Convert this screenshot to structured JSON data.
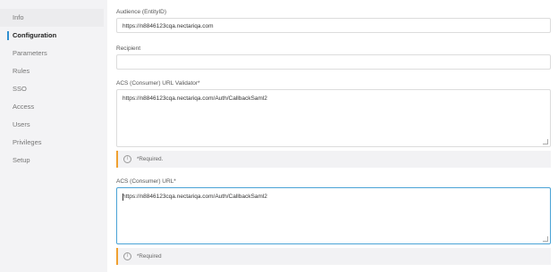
{
  "sidebar": {
    "items": [
      {
        "label": "Info"
      },
      {
        "label": "Configuration"
      },
      {
        "label": "Parameters"
      },
      {
        "label": "Rules"
      },
      {
        "label": "SSO"
      },
      {
        "label": "Access"
      },
      {
        "label": "Users"
      },
      {
        "label": "Privileges"
      },
      {
        "label": "Setup"
      }
    ]
  },
  "form": {
    "audience": {
      "label": "Audience (EntityID)",
      "value": "https://n8846123cqa.nectariqa.com"
    },
    "recipient": {
      "label": "Recipient",
      "value": ""
    },
    "acs_validator": {
      "label": "ACS (Consumer) URL Validator*",
      "value": "https://n8846123cqa.nectariqa.com/Auth/CallbackSaml2",
      "hint": "*Required."
    },
    "acs_url": {
      "label": "ACS (Consumer) URL*",
      "value": "https://n8846123cqa.nectariqa.com/Auth/CallbackSaml2",
      "hint": "*Required"
    }
  },
  "colors": {
    "accent": "#2f8fd0",
    "hint_border": "#f0a030",
    "focus_border": "#4aa3d6"
  },
  "icons": {
    "hint": "info-icon"
  }
}
